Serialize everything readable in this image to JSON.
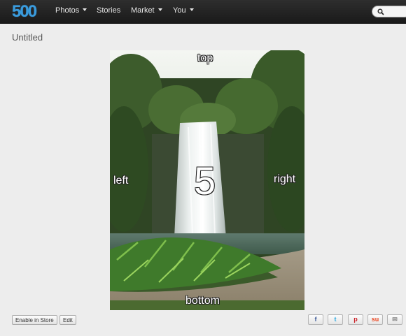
{
  "header": {
    "logo": "500",
    "nav": [
      {
        "label": "Photos",
        "dropdown": true
      },
      {
        "label": "Stories",
        "dropdown": false
      },
      {
        "label": "Market",
        "dropdown": true
      },
      {
        "label": "You",
        "dropdown": true
      }
    ]
  },
  "photo": {
    "title": "Untitled",
    "overlay": {
      "top": "top",
      "left": "left",
      "right": "right",
      "bottom": "bottom",
      "center": "5"
    }
  },
  "actions": {
    "enable_store": "Enable in Store",
    "edit": "Edit"
  },
  "share": [
    {
      "icon": "facebook-icon",
      "glyph": "f",
      "color": "#3b5998"
    },
    {
      "icon": "twitter-icon",
      "glyph": "t",
      "color": "#2ba9e1"
    },
    {
      "icon": "pinterest-icon",
      "glyph": "p",
      "color": "#cb2027"
    },
    {
      "icon": "stumbleupon-icon",
      "glyph": "su",
      "color": "#eb4823"
    },
    {
      "icon": "email-icon",
      "glyph": "✉",
      "color": "#888888"
    }
  ]
}
